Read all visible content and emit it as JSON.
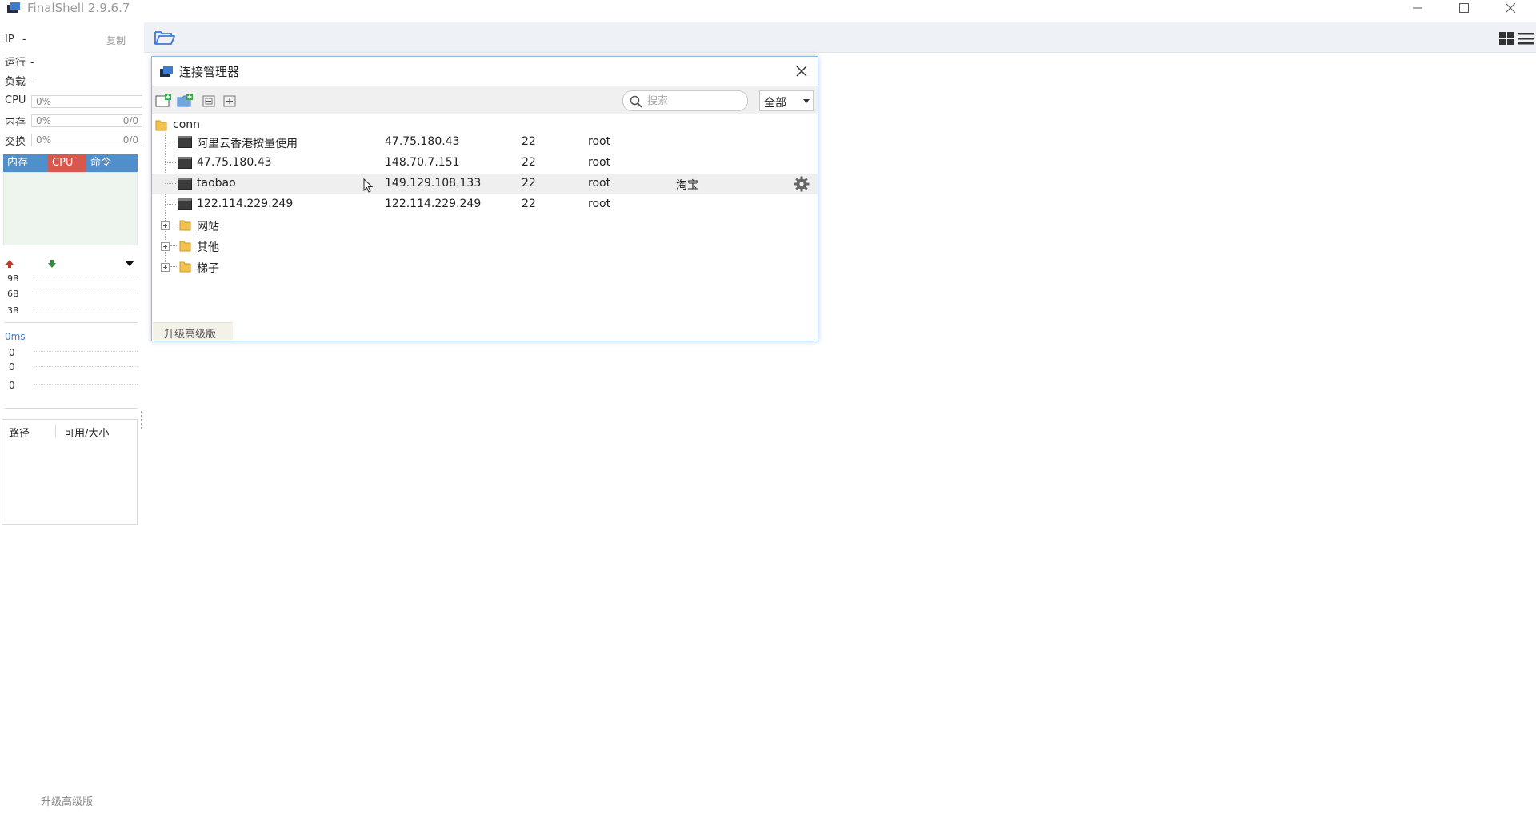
{
  "window": {
    "title": "FinalShell 2.9.6.7"
  },
  "sidebar": {
    "ip_label": "IP",
    "ip_value": "-",
    "copy_label": "复制",
    "run_label": "运行",
    "run_value": "-",
    "load_label": "负载",
    "load_value": "-",
    "metrics": [
      {
        "label": "CPU",
        "percent": "0%",
        "ratio": ""
      },
      {
        "label": "内存",
        "percent": "0%",
        "ratio": "0/0"
      },
      {
        "label": "交换",
        "percent": "0%",
        "ratio": "0/0"
      }
    ],
    "process_tabs": [
      "内存",
      "CPU",
      "命令"
    ],
    "net_ticks": [
      "9B",
      "6B",
      "3B"
    ],
    "ping_label": "0ms",
    "ping_ticks": [
      "0",
      "0",
      "0"
    ],
    "disk_columns": [
      "路径",
      "可用/大小"
    ],
    "upgrade_label": "升级高级版"
  },
  "dialog": {
    "title": "连接管理器",
    "search_placeholder": "搜索",
    "filter_value": "全部",
    "root_folder": "conn",
    "connections": [
      {
        "name": "阿里云香港按量使用",
        "host": "47.75.180.43",
        "port": "22",
        "user": "root",
        "note": ""
      },
      {
        "name": "47.75.180.43",
        "host": "148.70.7.151",
        "port": "22",
        "user": "root",
        "note": ""
      },
      {
        "name": "taobao",
        "host": "149.129.108.133",
        "port": "22",
        "user": "root",
        "note": "淘宝"
      },
      {
        "name": "122.114.229.249",
        "host": "122.114.229.249",
        "port": "22",
        "user": "root",
        "note": ""
      }
    ],
    "folders": [
      "网站",
      "其他",
      "梯子"
    ],
    "upgrade_label": "升级高级版"
  },
  "colors": {
    "accent_blue": "#4e8fcc",
    "cpu_tab_red": "#d9584e",
    "folder_yellow": "#f2c14e",
    "toolbar_bg": "#eef1f5"
  },
  "icons": {
    "open_folder": "folder-open-icon",
    "new_connection": "new-connection-icon",
    "new_folder": "new-folder-icon",
    "collapse": "collapse-all-icon",
    "expand": "expand-all-icon",
    "settings": "gear-icon"
  }
}
